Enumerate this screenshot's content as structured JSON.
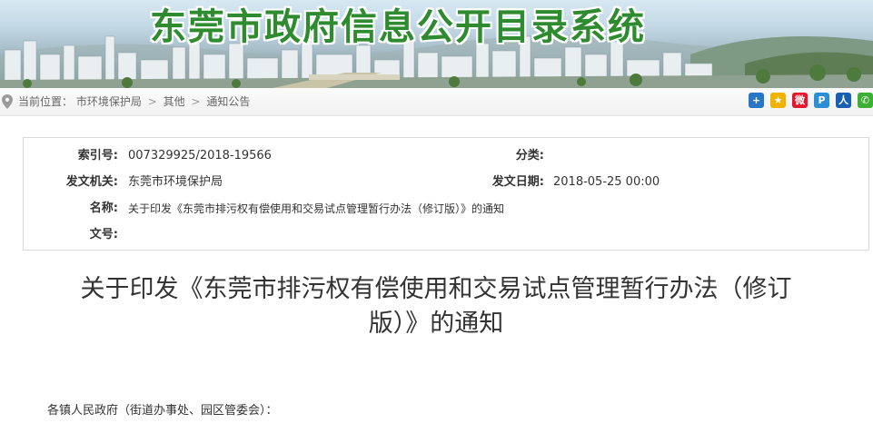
{
  "banner": {
    "title": "东莞市政府信息公开目录系统"
  },
  "breadcrumb": {
    "prefix": "当前位置：",
    "items": [
      "市环境保护局",
      "其他",
      "通知公告"
    ],
    "separator": ">"
  },
  "share": [
    {
      "icon": "plus-share-icon",
      "glyph": "+",
      "color": "#2a76c6"
    },
    {
      "icon": "qzone-share-icon",
      "glyph": "★",
      "color": "#f0b400"
    },
    {
      "icon": "weibo-share-icon",
      "glyph": "微",
      "color": "#e6162d"
    },
    {
      "icon": "qq-share-icon",
      "glyph": "P",
      "color": "#2a8fd6"
    },
    {
      "icon": "renren-share-icon",
      "glyph": "人",
      "color": "#1a5fb4"
    },
    {
      "icon": "wechat-share-icon",
      "glyph": "✆",
      "color": "#3cb034"
    }
  ],
  "info": {
    "index_label": "索引号:",
    "index_value": "007329925/2018-19566",
    "category_label": "分类:",
    "category_value": "",
    "issuer_label": "发文机关:",
    "issuer_value": "东莞市环境保护局",
    "date_label": "发文日期:",
    "date_value": "2018-05-25 00:00",
    "name_label": "名称:",
    "name_value": "关于印发《东莞市排污权有偿使用和交易试点管理暂行办法（修订版）》的通知",
    "docno_label": "文号:",
    "docno_value": ""
  },
  "article": {
    "title_line1": "关于印发《东莞市排污权有偿使用和交易试点管理暂行办法（修订",
    "title_line2": "版）》的通知",
    "greeting": "各镇人民政府（街道办事处、园区管委会）："
  }
}
